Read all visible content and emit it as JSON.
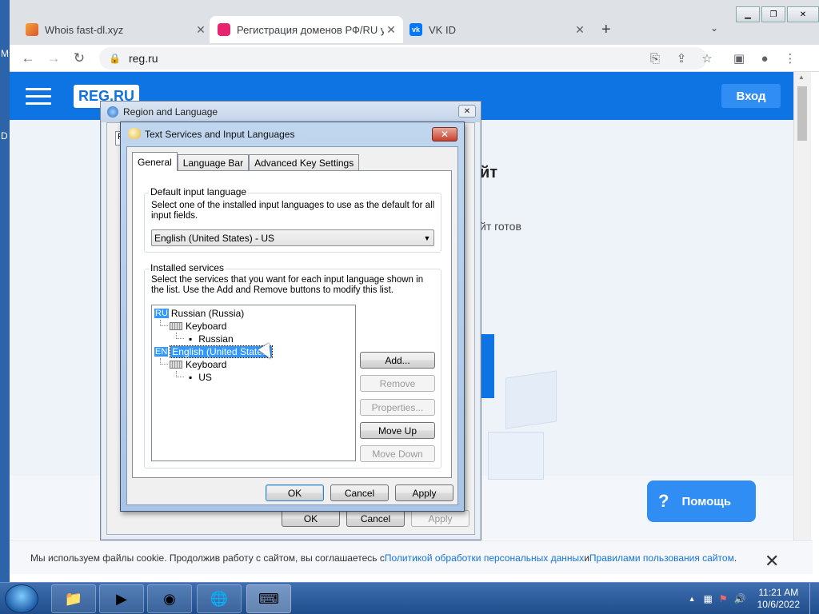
{
  "browser": {
    "tabs": [
      {
        "title": "Whois fast-dl.xyz",
        "active": false,
        "icon": "whois-favicon"
      },
      {
        "title": "Регистрация доменов РФ/RU у",
        "active": true,
        "icon": "regru-favicon"
      },
      {
        "title": "VK ID",
        "active": false,
        "icon": "vk-favicon"
      }
    ],
    "new_tab": "+",
    "url": "reg.ru"
  },
  "site": {
    "logo": "REG.RU",
    "login": "Вход",
    "hero_title": "йт",
    "hero_text": "йт готов",
    "help": "Помощь",
    "cookie": {
      "text1": "Мы используем файлы cookie. Продолжив работу с сайтом, вы соглашаетесь с ",
      "link1": "Политикой обработки персональных данных",
      "text2": " и ",
      "link2": "Правилами пользования сайтом",
      "text3": "."
    }
  },
  "outer_dialog": {
    "title": "Region and Language",
    "tab_stub": "F",
    "buttons": {
      "ok": "OK",
      "cancel": "Cancel",
      "apply": "Apply"
    }
  },
  "inner_dialog": {
    "title": "Text Services and Input Languages",
    "tabs": [
      "General",
      "Language Bar",
      "Advanced Key Settings"
    ],
    "default_group": {
      "label": "Default input language",
      "desc": "Select one of the installed input languages to use as the default for all input fields.",
      "selected": "English (United States) - US"
    },
    "services_group": {
      "label": "Installed services",
      "desc": "Select the services that you want for each input language shown in the list. Use the Add and Remove buttons to modify this list.",
      "tree": {
        "ru_badge": "RU",
        "ru_lang": "Russian (Russia)",
        "ru_cat": "Keyboard",
        "ru_layout": "Russian",
        "en_badge": "EN",
        "en_lang": "English (United States)",
        "en_cat": "Keyboard",
        "en_layout": "US"
      },
      "buttons": {
        "add": "Add...",
        "remove": "Remove",
        "properties": "Properties...",
        "move_up": "Move Up",
        "move_down": "Move Down"
      }
    },
    "buttons": {
      "ok": "OK",
      "cancel": "Cancel",
      "apply": "Apply"
    }
  },
  "taskbar": {
    "time": "11:21 AM",
    "date": "10/6/2022"
  },
  "colors": {
    "brand": "#0f74e3",
    "selection": "#3399ff"
  }
}
